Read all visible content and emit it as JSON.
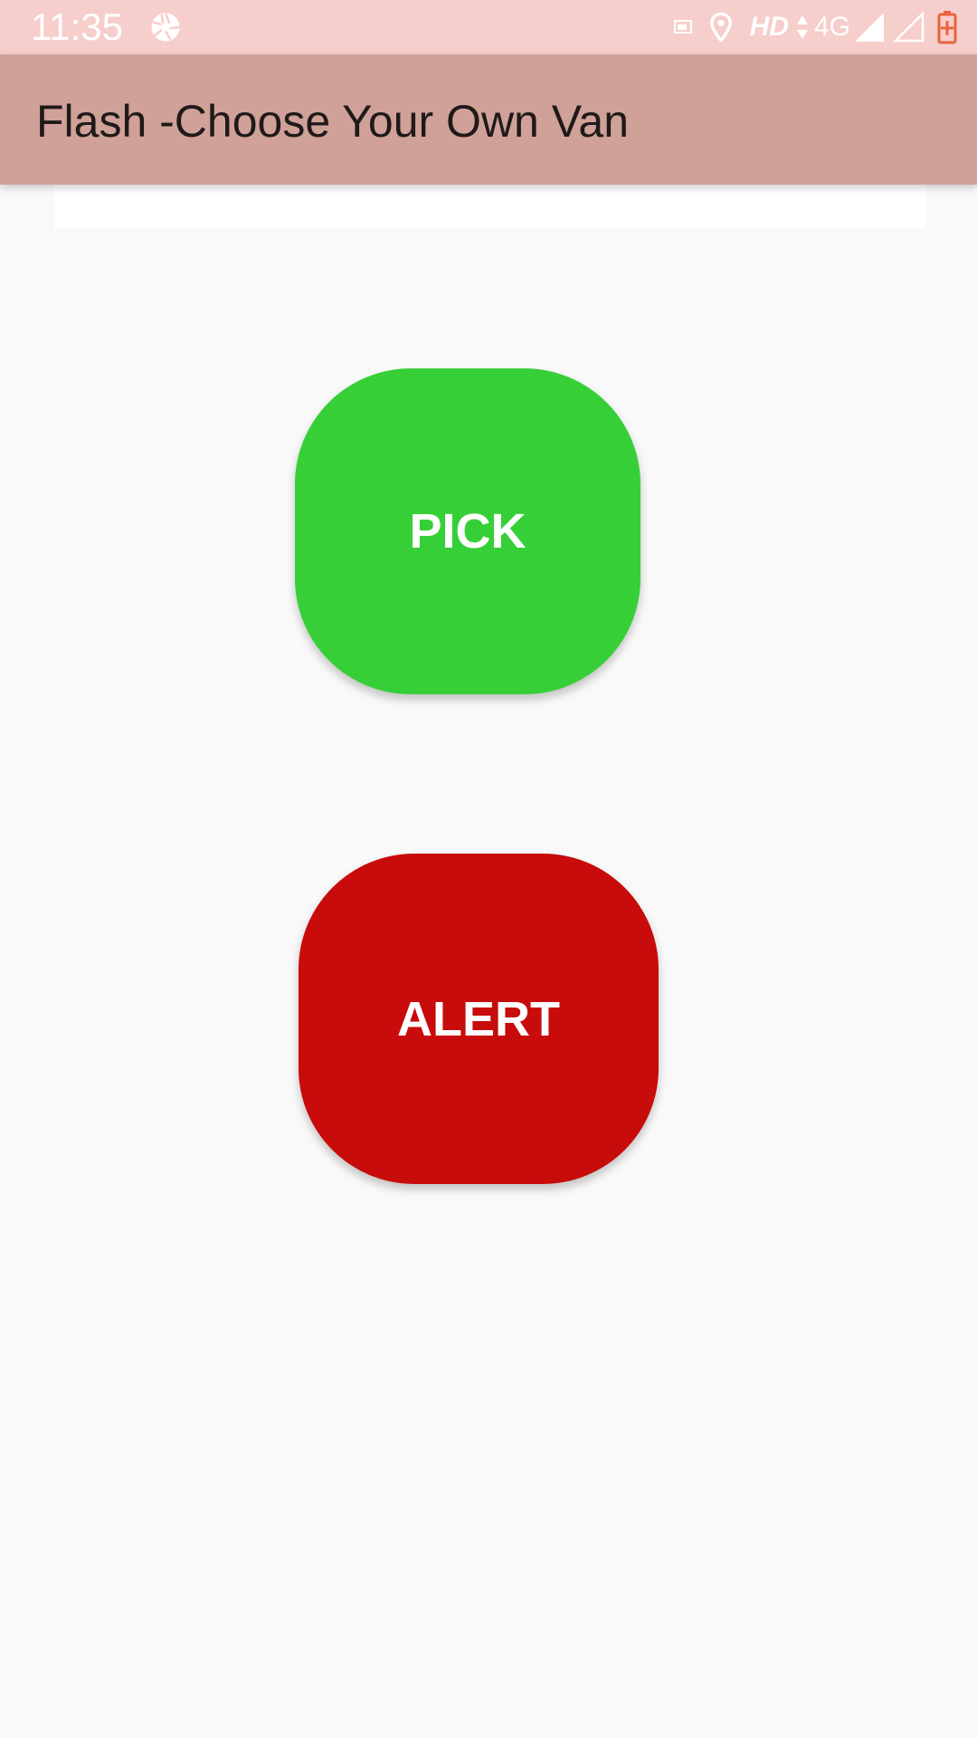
{
  "status_bar": {
    "time": "11:35",
    "network_label": "HD",
    "network_type": "4G",
    "icons": [
      "aperture-icon",
      "cast-icon",
      "location-icon",
      "data-arrows-icon",
      "signal-icon",
      "signal-empty-icon",
      "battery-charging-icon"
    ]
  },
  "app_bar": {
    "title": "Flash -Choose Your Own Van"
  },
  "buttons": {
    "pick_label": "PICK",
    "alert_label": "ALERT"
  },
  "colors": {
    "status_bar": "#f6cecb",
    "app_bar": "#d0a198",
    "pick": "#37cf37",
    "alert": "#c80b0b",
    "background": "#f9f9f9",
    "battery": "#e8623e"
  }
}
